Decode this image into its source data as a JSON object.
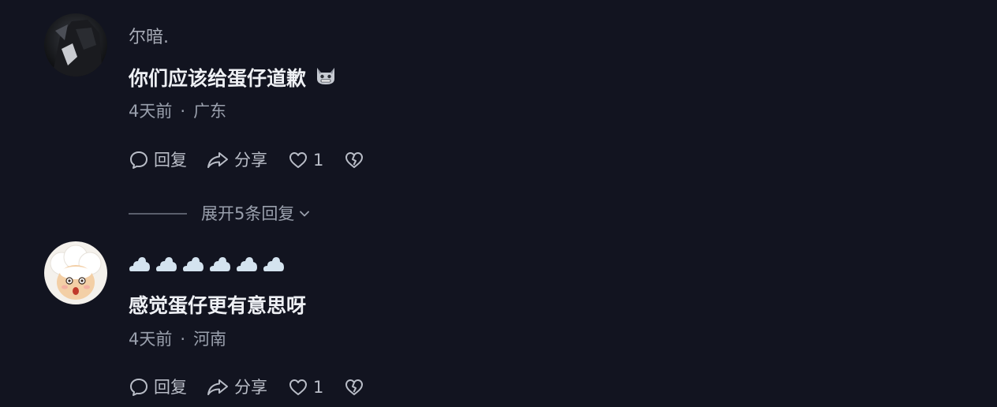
{
  "comments": [
    {
      "username": "尔暗.",
      "content": "你们应该给蛋仔道歉",
      "content_emoji": "grimacing-cat-emoji",
      "time": "4天前",
      "separator": "·",
      "location": "广东",
      "reply_label": "回复",
      "share_label": "分享",
      "likes": "1"
    },
    {
      "username_icon": "cloud-icon",
      "username_icon_count": 6,
      "content": "感觉蛋仔更有意思呀",
      "time": "4天前",
      "separator": "·",
      "location": "河南",
      "reply_label": "回复",
      "share_label": "分享",
      "likes": "1"
    }
  ],
  "expand_replies": {
    "label": "展开5条回复"
  },
  "colors": {
    "background": "#121420",
    "username": "#a7abb6",
    "content": "#eef0f4",
    "meta": "#9aa0ad"
  }
}
